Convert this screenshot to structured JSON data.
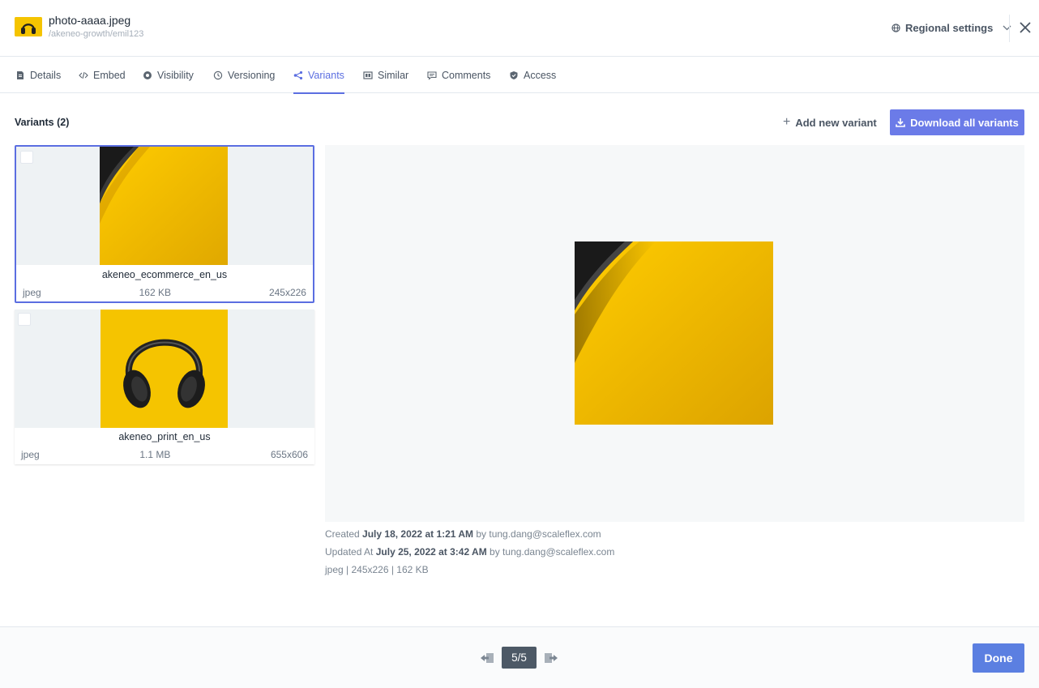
{
  "header": {
    "file_title": "photo-aaaa.jpeg",
    "file_path": "/akeneo-growth/emil123",
    "regional_settings_label": "Regional settings",
    "icons": {
      "globe": "globe-icon",
      "chevron": "chevron-down-icon",
      "close": "close-icon"
    }
  },
  "tabs": [
    {
      "label": "Details",
      "icon": "document-icon",
      "active": false
    },
    {
      "label": "Embed",
      "icon": "code-icon",
      "active": false
    },
    {
      "label": "Visibility",
      "icon": "visibility-icon",
      "active": false
    },
    {
      "label": "Versioning",
      "icon": "history-icon",
      "active": false
    },
    {
      "label": "Variants",
      "icon": "variants-icon",
      "active": true
    },
    {
      "label": "Similar",
      "icon": "similar-icon",
      "active": false
    },
    {
      "label": "Comments",
      "icon": "comment-icon",
      "active": false
    },
    {
      "label": "Access",
      "icon": "shield-icon",
      "active": false
    }
  ],
  "toolbar": {
    "variants_count": "Variants (2)",
    "add_variant_label": "Add new variant",
    "download_all_label": "Download all variants"
  },
  "variants": [
    {
      "name": "akeneo_ecommerce_en_us",
      "format": "jpeg",
      "size": "162 KB",
      "dimensions": "245x226",
      "selected": true
    },
    {
      "name": "akeneo_print_en_us",
      "format": "jpeg",
      "size": "1.1 MB",
      "dimensions": "655x606",
      "selected": false
    }
  ],
  "details": {
    "created_prefix": "Created",
    "created_date": "July 18, 2022 at 1:21 AM",
    "created_by": "by tung.dang@scaleflex.com",
    "updated_prefix": "Updated At",
    "updated_date": "July 25, 2022 at 3:42 AM",
    "updated_by": "by tung.dang@scaleflex.com",
    "file_summary": "jpeg | 245x226 | 162 KB"
  },
  "footer": {
    "pager": "5/5",
    "done_label": "Done"
  },
  "colors": {
    "accent": "#5b6ee1",
    "primary_button": "#6b7be8",
    "done_button": "#5b7fe1",
    "photo_yellow": "#f5c400"
  }
}
